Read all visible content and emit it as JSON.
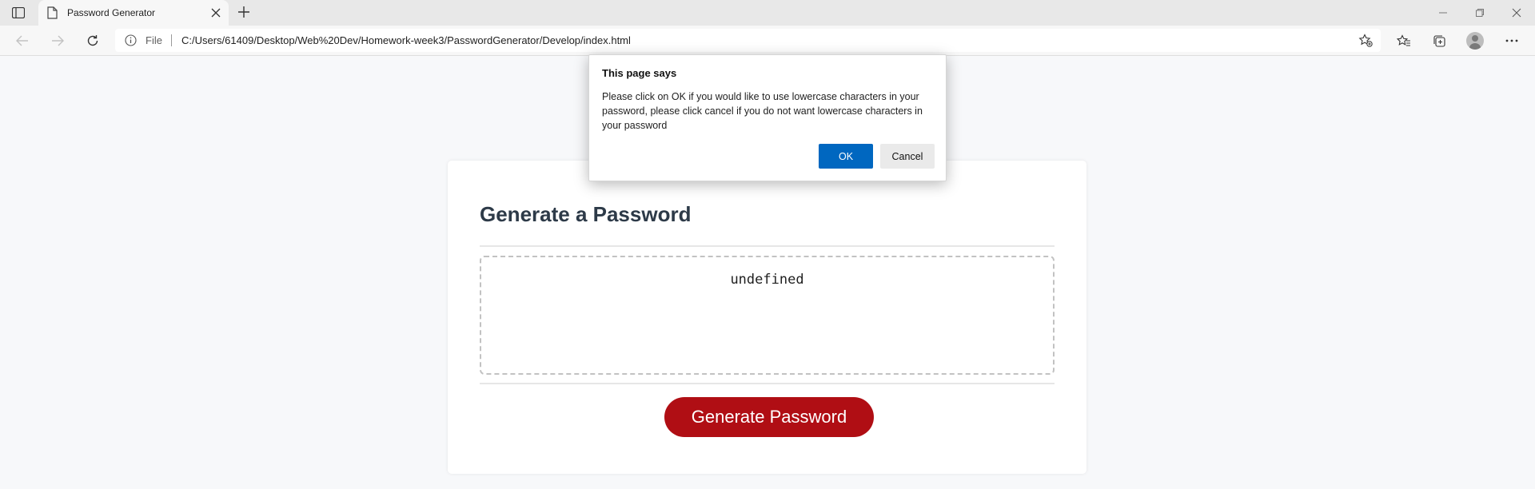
{
  "browser": {
    "tab": {
      "title": "Password Generator"
    },
    "address": {
      "scheme_label": "File",
      "url": "C:/Users/61409/Desktop/Web%20Dev/Homework-week3/PasswordGenerator/Develop/index.html"
    },
    "icons": [
      "tab-actions-icon",
      "page-icon",
      "close-icon",
      "new-tab-icon",
      "minimize-icon",
      "restore-icon",
      "window-close-icon",
      "back-icon",
      "forward-icon",
      "refresh-icon",
      "info-icon",
      "add-favorite-icon",
      "favorites-icon",
      "collections-icon",
      "avatar",
      "more-icon"
    ]
  },
  "page": {
    "card_title": "Generate a Password",
    "password_value": "undefined",
    "generate_button": "Generate Password"
  },
  "dialog": {
    "title": "This page says",
    "message": "Please click on OK if you would like to use lowercase characters in your password, please click cancel if you do not want lowercase characters in your password",
    "ok_label": "OK",
    "cancel_label": "Cancel"
  },
  "colors": {
    "button_red": "#b00e14",
    "dialog_ok_blue": "#0067c0",
    "title_text": "#2d3a48"
  }
}
